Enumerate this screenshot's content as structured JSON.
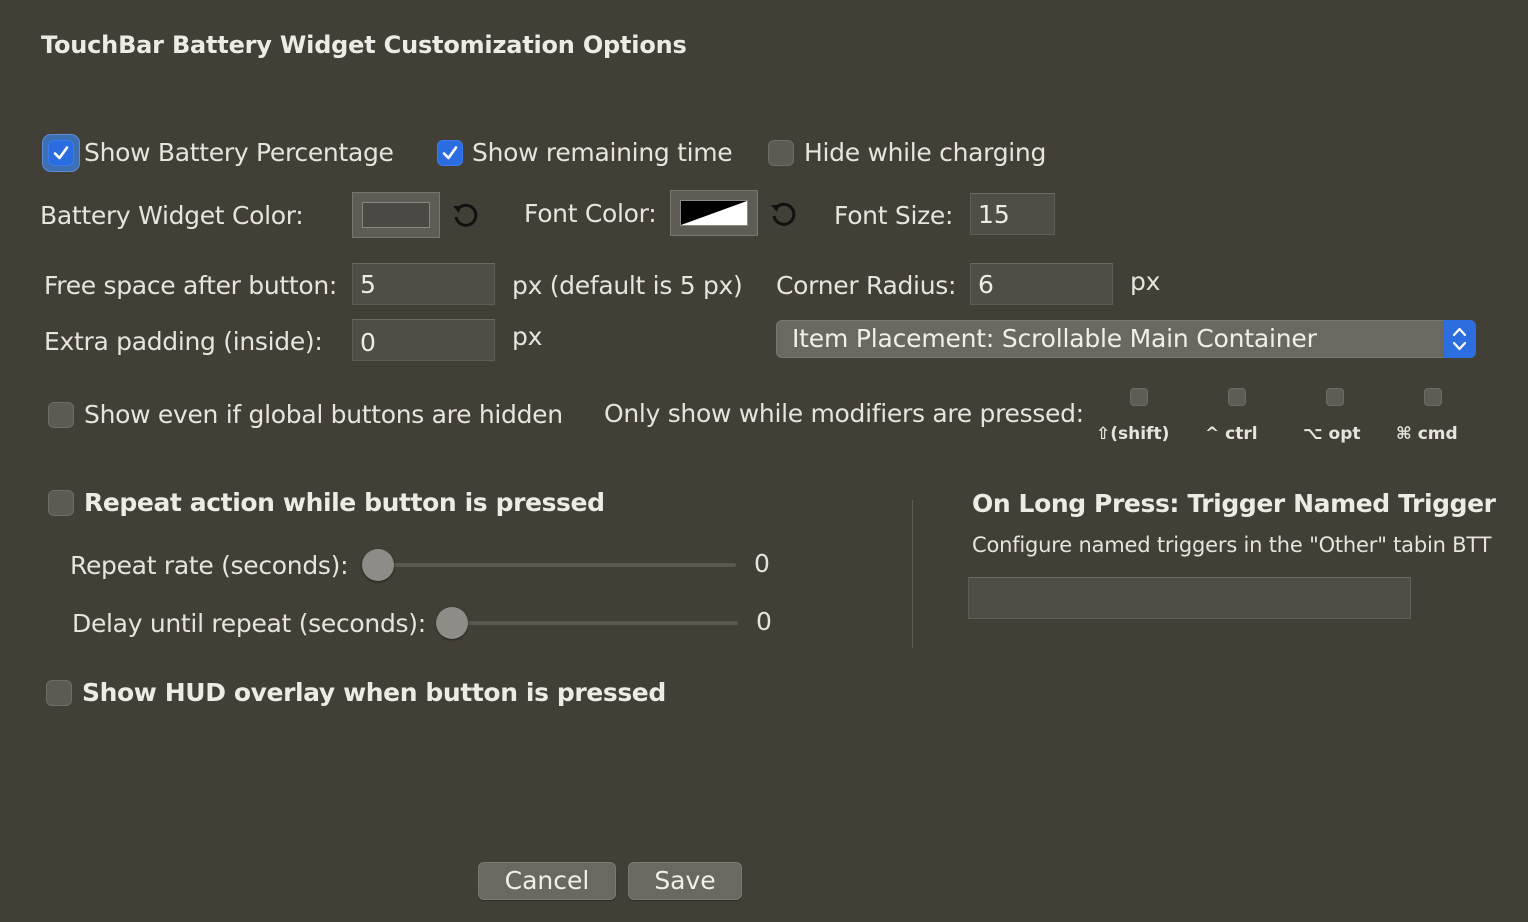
{
  "title": "TouchBar Battery Widget Customization Options",
  "checkboxes": {
    "show_percentage": {
      "label": "Show Battery Percentage",
      "checked": true
    },
    "show_remaining": {
      "label": "Show remaining time",
      "checked": true
    },
    "hide_charging": {
      "label": "Hide while charging",
      "checked": false
    },
    "show_global_hidden": {
      "label": "Show even if global buttons are hidden",
      "checked": false
    },
    "repeat_action": {
      "label": "Repeat action while button is pressed",
      "checked": false
    },
    "show_hud": {
      "label": "Show HUD overlay when button is pressed",
      "checked": false
    }
  },
  "colors": {
    "battery_label": "Battery Widget Color:",
    "battery_color": "#4a4943",
    "font_label": "Font Color:",
    "font_size_label": "Font Size:",
    "font_size_value": "15"
  },
  "spacing": {
    "free_space_label": "Free space after button:",
    "free_space_value": "5",
    "free_space_suffix": "px (default is 5 px)",
    "corner_radius_label": "Corner Radius:",
    "corner_radius_value": "6",
    "corner_radius_suffix": "px",
    "extra_padding_label": "Extra padding (inside):",
    "extra_padding_value": "0",
    "extra_padding_suffix": "px"
  },
  "placement": {
    "selected": "Item Placement: Scrollable Main Container"
  },
  "modifiers": {
    "label": "Only show while modifiers are pressed:",
    "items": [
      "⇧(shift)",
      "^ ctrl",
      "⌥ opt",
      "⌘ cmd"
    ]
  },
  "repeat": {
    "rate_label": "Repeat rate (seconds):",
    "rate_value": "0",
    "delay_label": "Delay until repeat (seconds):",
    "delay_value": "0"
  },
  "long_press": {
    "title": "On Long Press: Trigger Named Trigger",
    "hint": "Configure named triggers in the \"Other\" tabin BTT",
    "value": ""
  },
  "buttons": {
    "cancel": "Cancel",
    "save": "Save"
  },
  "accent_color": "#2b6ce0"
}
